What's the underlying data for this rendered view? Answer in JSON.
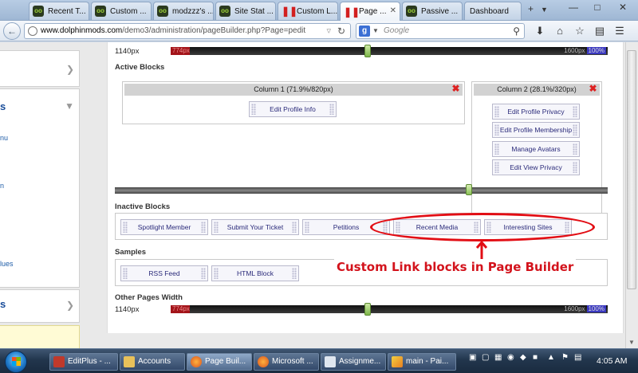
{
  "browser": {
    "tabs": [
      {
        "label": "Recent T...",
        "icon": "dolphin-icon"
      },
      {
        "label": "Custom ...",
        "icon": "dolphin-icon"
      },
      {
        "label": "modzzz's ...",
        "icon": "dolphin-icon"
      },
      {
        "label": "Site Stat ...",
        "icon": "dolphin-icon"
      },
      {
        "label": "Custom L...",
        "icon": "pause-icon"
      },
      {
        "label": "Page ...",
        "icon": "pause-icon"
      },
      {
        "label": "Passive ...",
        "icon": "dolphin-icon"
      },
      {
        "label": "Dashboard",
        "icon": "none"
      }
    ],
    "active_tab": 5,
    "url_domain": "www.dolphinmods.com",
    "url_path": "/demo3/administration/pageBuilder.php?Page=pedit",
    "search_placeholder": "Google"
  },
  "sidebar": {
    "heading1": "s",
    "link1": "nu",
    "link2": "n",
    "link3": "lues",
    "heading2": "s"
  },
  "page_width_top": {
    "value_label": "1140px",
    "min": "774px",
    "max": "1600px",
    "percent": "100%",
    "handle_fraction": 0.65
  },
  "active_blocks": {
    "title": "Active Blocks",
    "column1": {
      "header": "Column 1 (71.9%/820px)",
      "blocks": [
        "Edit Profile Info"
      ]
    },
    "column2": {
      "header": "Column 2 (28.1%/320px)",
      "blocks": [
        "Edit Profile Privacy",
        "Edit Profile Membership",
        "Manage Avatars",
        "Edit View Privacy"
      ]
    },
    "column_split_fraction": 0.719
  },
  "inactive_blocks": {
    "title": "Inactive Blocks",
    "blocks": [
      "Spotlight Member",
      "Submit Your Ticket",
      "Petitions",
      "Recent Media",
      "Interesting Sites"
    ]
  },
  "samples": {
    "title": "Samples",
    "blocks": [
      "RSS Feed",
      "HTML Block"
    ]
  },
  "other_pages_width": {
    "title": "Other Pages Width",
    "value_label": "1140px",
    "min": "774px",
    "max": "1600px",
    "percent": "100%",
    "handle_fraction": 0.65
  },
  "annotation": {
    "text": "Custom Link blocks in Page Builder",
    "color": "#d3131c"
  },
  "taskbar": {
    "items": [
      {
        "label": "EditPlus - ...",
        "icon": "editplus-icon"
      },
      {
        "label": "Accounts",
        "icon": "folder-icon"
      },
      {
        "label": "Page Buil...",
        "icon": "firefox-icon"
      },
      {
        "label": "Microsoft ...",
        "icon": "firefox-icon"
      },
      {
        "label": "Assignme...",
        "icon": "document-icon"
      },
      {
        "label": "main - Pai...",
        "icon": "paint-icon"
      }
    ],
    "active_item": 2,
    "clock": "4:05 AM"
  }
}
